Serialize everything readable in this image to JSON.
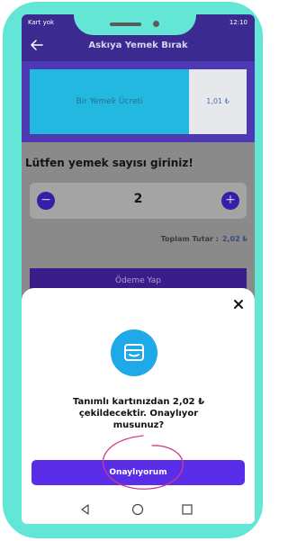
{
  "status_bar": {
    "carrier": "Kart yok",
    "time": "12:10"
  },
  "app_bar": {
    "title": "Askıya Yemek Bırak",
    "back_icon": "arrow-left-icon"
  },
  "fee": {
    "label": "Bir Yemek Ücreti",
    "value": "1,01 ₺"
  },
  "form": {
    "prompt": "Lütfen yemek sayısı giriniz!",
    "count": "2",
    "minus_symbol": "−",
    "plus_symbol": "+",
    "total_label": "Toplam Tutar :",
    "total_value": "2,02 ₺",
    "pay_button": "Ödeme Yap"
  },
  "dialog": {
    "close_icon": "close-icon",
    "card_icon": "card-wallet-icon",
    "message": "Tanımlı kartınızdan 2,02 ₺ çekildecektir. Onaylıyor musunuz?",
    "confirm_button": "Onaylıyorum"
  },
  "nav": {
    "icons": [
      "back-triangle-icon",
      "home-circle-icon",
      "recents-square-icon"
    ]
  },
  "colors": {
    "frame": "#63e6d6",
    "app_bar": "#3b2a8f",
    "fee_left": "#22b8e0",
    "stepper_button": "#3420a6",
    "confirm_button": "#5a2ee8",
    "annotation": "#d03a8c"
  }
}
